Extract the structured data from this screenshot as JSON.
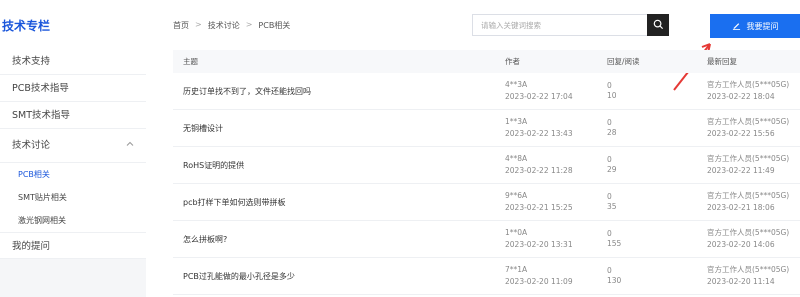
{
  "sidebar": {
    "title": "技术专栏",
    "items": [
      {
        "label": "技术支持"
      },
      {
        "label": "PCB技术指导"
      },
      {
        "label": "SMT技术指导"
      }
    ],
    "group": {
      "label": "技术讨论",
      "arrow": "chevron-up-icon"
    },
    "subitems": [
      {
        "label": "PCB相关",
        "active": true
      },
      {
        "label": "SMT贴片相关",
        "active": false
      },
      {
        "label": "激光钢网相关",
        "active": false
      }
    ],
    "last": {
      "label": "我的提问"
    },
    "colors": {
      "accent": "#1a56db"
    }
  },
  "breadcrumb": [
    "首页",
    "技术讨论",
    "PCB相关"
  ],
  "search": {
    "placeholder": "请输入关键词搜索",
    "value": "",
    "icon": "search-icon"
  },
  "ask_button": {
    "label": "我要提问",
    "icon": "edit-icon",
    "color": "#1a6ff0"
  },
  "annotation": {
    "color": "#e53935"
  },
  "table": {
    "headers": {
      "title": "主题",
      "author": "作者",
      "reply": "回复/阅读",
      "latest": "最新回复"
    },
    "rows": [
      {
        "title": "历史订单找不到了，文件还能找回吗",
        "author": "4**3A",
        "date": "2023-02-22 17:04",
        "replies": "0",
        "views": "10",
        "latest_user": "官方工作人员(5***05G)",
        "latest_date": "2023-02-22 18:04"
      },
      {
        "title": "无铜槽设计",
        "author": "1**3A",
        "date": "2023-02-22 13:43",
        "replies": "0",
        "views": "28",
        "latest_user": "官方工作人员(5***05G)",
        "latest_date": "2023-02-22 15:56"
      },
      {
        "title": "RoHS证明的提供",
        "author": "4**8A",
        "date": "2023-02-22 11:28",
        "replies": "0",
        "views": "29",
        "latest_user": "官方工作人员(5***05G)",
        "latest_date": "2023-02-22 11:49"
      },
      {
        "title": "pcb打样下单如何选则带拼板",
        "author": "9**6A",
        "date": "2023-02-21 15:25",
        "replies": "0",
        "views": "35",
        "latest_user": "官方工作人员(5***05G)",
        "latest_date": "2023-02-21 18:06"
      },
      {
        "title": "怎么拼板啊?",
        "author": "1**0A",
        "date": "2023-02-20 13:31",
        "replies": "0",
        "views": "155",
        "latest_user": "官方工作人员(5***05G)",
        "latest_date": "2023-02-20 14:06"
      },
      {
        "title": "PCB过孔能做的最小孔径是多少",
        "author": "7**1A",
        "date": "2023-02-20 11:09",
        "replies": "0",
        "views": "130",
        "latest_user": "官方工作人员(5***05G)",
        "latest_date": "2023-02-20 11:14"
      }
    ]
  }
}
